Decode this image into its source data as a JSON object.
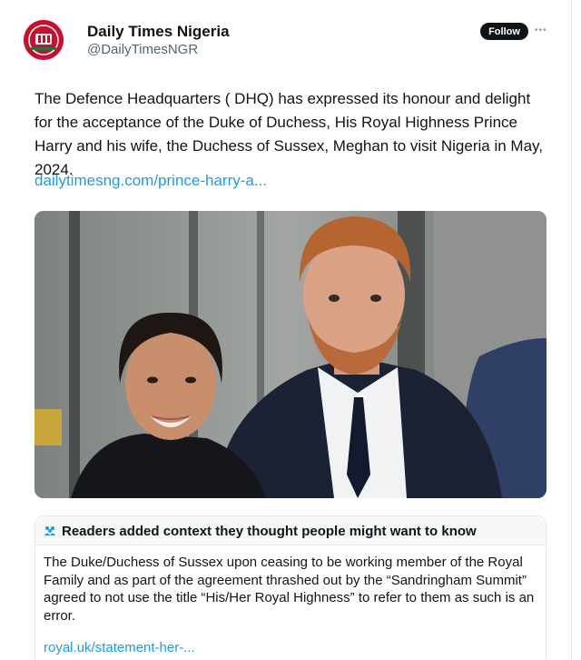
{
  "post": {
    "author": {
      "display_name": "Daily Times Nigeria",
      "handle": "@DailyTimesNGR",
      "avatar_icon": "daily-times-logo-icon",
      "brand_color": "#c8102e"
    },
    "follow_label": "Follow",
    "more_icon": "ellipsis-icon",
    "text": "The Defence Headquarters ( DHQ) has expressed its honour and delight for the acceptance of the Duke of Duchess, His Royal Highness Prince Harry and his wife, the Duchess of Sussex, Meghan to visit Nigeria in May, 2024.",
    "link_text": "dailytimesng.com/prince-harry-a...",
    "link_color": "#1d9bf0"
  },
  "community_note": {
    "icon": "people-icon",
    "title": "Readers added context they thought people might want to know",
    "text": "The Duke/Duchess of Sussex upon ceasing to be working member of the Royal Family and as part of the agreement thrashed out by the “Sandringham Summit” agreed to not use the title “His/Her Royal Highness” to refer to them as such is an error.",
    "link_text": "royal.uk/statement-her-..."
  }
}
